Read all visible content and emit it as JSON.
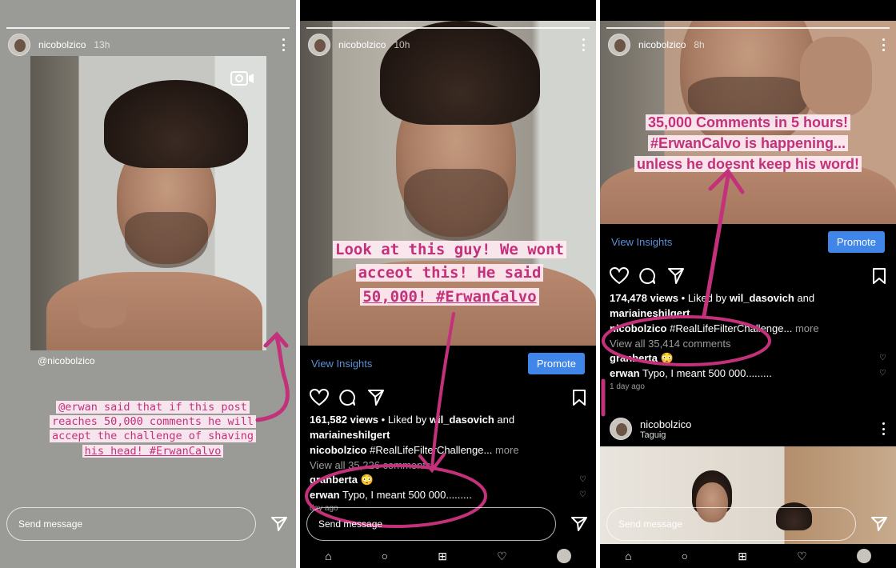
{
  "panels": [
    {
      "username": "nicobolzico",
      "time": "13h",
      "mention": "@nicobolzico",
      "annotation": [
        "@erwan said that if this post",
        "reaches 50,000 comments he will",
        "accept the challenge of shaving",
        "his head! #ErwanCalvo"
      ],
      "send_placeholder": "Send message"
    },
    {
      "username": "nicobolzico",
      "time": "10h",
      "annotation": [
        "Look at this guy! We wont",
        "acceot this! He said",
        "50,000! #ErwanCalvo"
      ],
      "view_insights": "View Insights",
      "promote": "Promote",
      "views": "161,582 views",
      "liked_by_prefix": "• Liked by",
      "liked_user": "wil_dasovich",
      "liked_and": "and",
      "liked_user2": "mariaineshilgert",
      "caption_user": "nicobolzico",
      "caption_text": "#RealLifeFilterChallenge...",
      "more": "more",
      "view_comments": "View all 35,226 comments",
      "comments": [
        {
          "user": "granberta",
          "text": "😳"
        },
        {
          "user": "erwan",
          "text": "Typo, I meant 500 000........."
        }
      ],
      "comment_age": "day ago",
      "send_placeholder": "Send message"
    },
    {
      "username": "nicobolzico",
      "time": "8h",
      "annotation": [
        "35,000 Comments in 5 hours!",
        "#ErwanCalvo is happening...",
        "unless he doesnt keep his word!"
      ],
      "view_insights": "View Insights",
      "promote": "Promote",
      "views": "174,478 views",
      "liked_by_prefix": "• Liked by",
      "liked_user": "wil_dasovich",
      "liked_and": "and",
      "liked_user2": "mariaineshilgert",
      "caption_user": "nicobolzico",
      "caption_text": "#RealLifeFilterChallenge...",
      "more": "more",
      "view_comments": "View all 35,414 comments",
      "comments": [
        {
          "user": "granberta",
          "text": "😳"
        },
        {
          "user": "erwan",
          "text": "Typo, I meant 500 000........."
        }
      ],
      "comment_age": "1 day ago",
      "post_user": "nicobolzico",
      "post_location": "Taguig",
      "send_placeholder": "Send message"
    }
  ],
  "colors": {
    "annotation": "#c2317a",
    "link": "#5b8fd6",
    "promote": "#3f86e8"
  }
}
